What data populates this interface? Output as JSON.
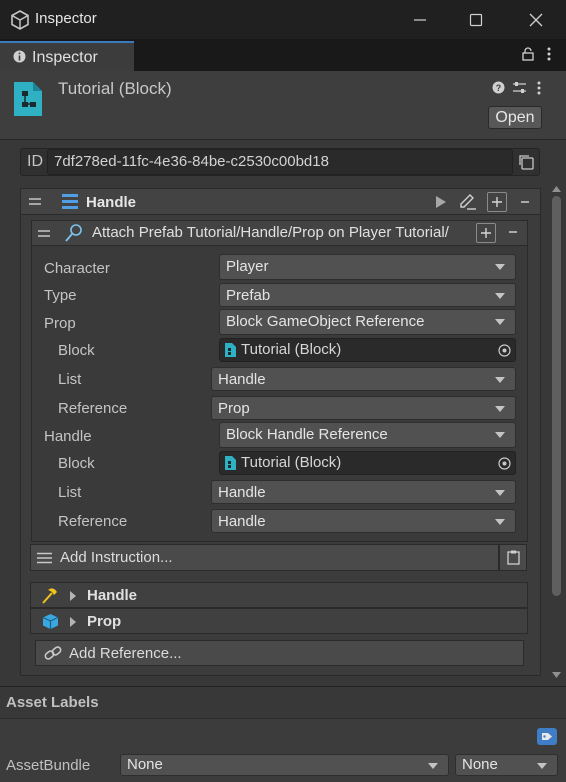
{
  "window": {
    "title": "Inspector"
  },
  "tab": {
    "label": "Inspector"
  },
  "header": {
    "object_name": "Tutorial (Block)",
    "open_button": "Open"
  },
  "id_field": {
    "label": "ID",
    "value": "7df278ed-11fc-4e36-84be-c2530c00bd18"
  },
  "list": {
    "title": "Handle"
  },
  "instruction": {
    "title": "Attach Prefab Tutorial/Handle/Prop on Player Tutorial/"
  },
  "fields": {
    "character": {
      "label": "Character",
      "value": "Player"
    },
    "type": {
      "label": "Type",
      "value": "Prefab"
    },
    "prop": {
      "label": "Prop",
      "value": "Block GameObject Reference"
    },
    "prop_block": {
      "label": "Block",
      "value": "Tutorial (Block)"
    },
    "prop_list": {
      "label": "List",
      "value": "Handle"
    },
    "prop_reference": {
      "label": "Reference",
      "value": "Prop"
    },
    "handle": {
      "label": "Handle",
      "value": "Block Handle Reference"
    },
    "handle_block": {
      "label": "Block",
      "value": "Tutorial (Block)"
    },
    "handle_list": {
      "label": "List",
      "value": "Handle"
    },
    "handle_reference": {
      "label": "Reference",
      "value": "Handle"
    }
  },
  "add_instruction": "Add Instruction...",
  "references": [
    {
      "label": "Handle",
      "icon": "hammer-icon"
    },
    {
      "label": "Prop",
      "icon": "cube-icon"
    }
  ],
  "add_reference": "Add Reference...",
  "asset_labels": {
    "title": "Asset Labels",
    "assetbundle_label": "AssetBundle",
    "bundle_value": "None",
    "variant_value": "None"
  },
  "colors": {
    "accent": "#3a79bb",
    "bg": "#383838",
    "header": "#3e3e3e"
  }
}
